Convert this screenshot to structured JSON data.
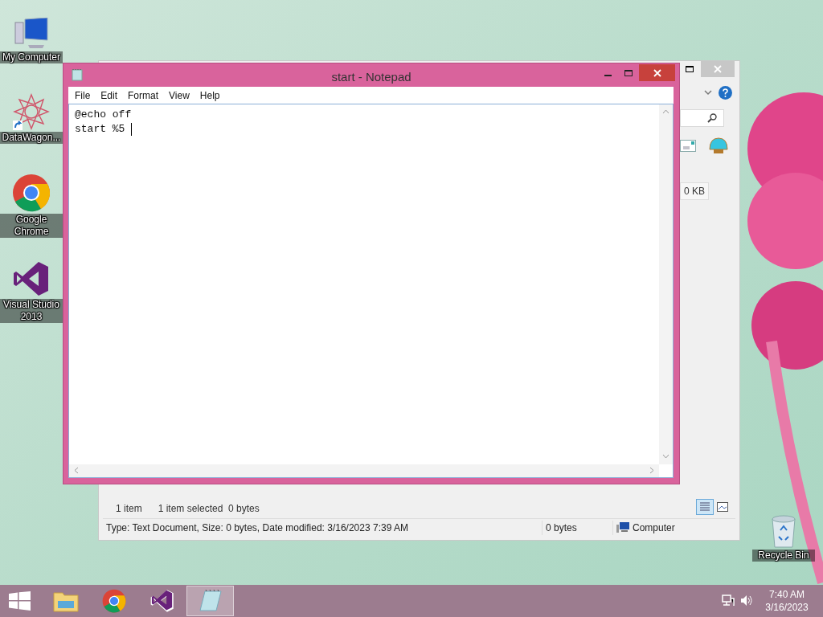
{
  "desktop_icons": [
    {
      "kind": "computer",
      "label": "My Computer"
    },
    {
      "kind": "datawagon",
      "label": "DataWagon..."
    },
    {
      "kind": "chrome",
      "label": "Google Chrome"
    },
    {
      "kind": "vs",
      "label": "Visual Studio 2013"
    },
    {
      "kind": "recycle",
      "label": "Recycle Bin"
    }
  ],
  "explorer": {
    "size_text": "0 KB",
    "status_items": [
      "1 item",
      "1 item selected  0 bytes"
    ],
    "details": "Type: Text Document, Size: 0 bytes, Date modified: 3/16/2023 7:39 AM",
    "details_size": "0 bytes",
    "details_location": "Computer"
  },
  "notepad": {
    "title": "start - Notepad",
    "menu": [
      "File",
      "Edit",
      "Format",
      "View",
      "Help"
    ],
    "lines": [
      "@echo off",
      "start %5 "
    ]
  },
  "taskbar": {
    "apps": [
      {
        "kind": "explorer",
        "selected": false
      },
      {
        "kind": "chrome",
        "selected": false
      },
      {
        "kind": "vs",
        "selected": false
      },
      {
        "kind": "notepad",
        "selected": true
      }
    ],
    "time": "7:40 AM",
    "date": "3/16/2023"
  }
}
